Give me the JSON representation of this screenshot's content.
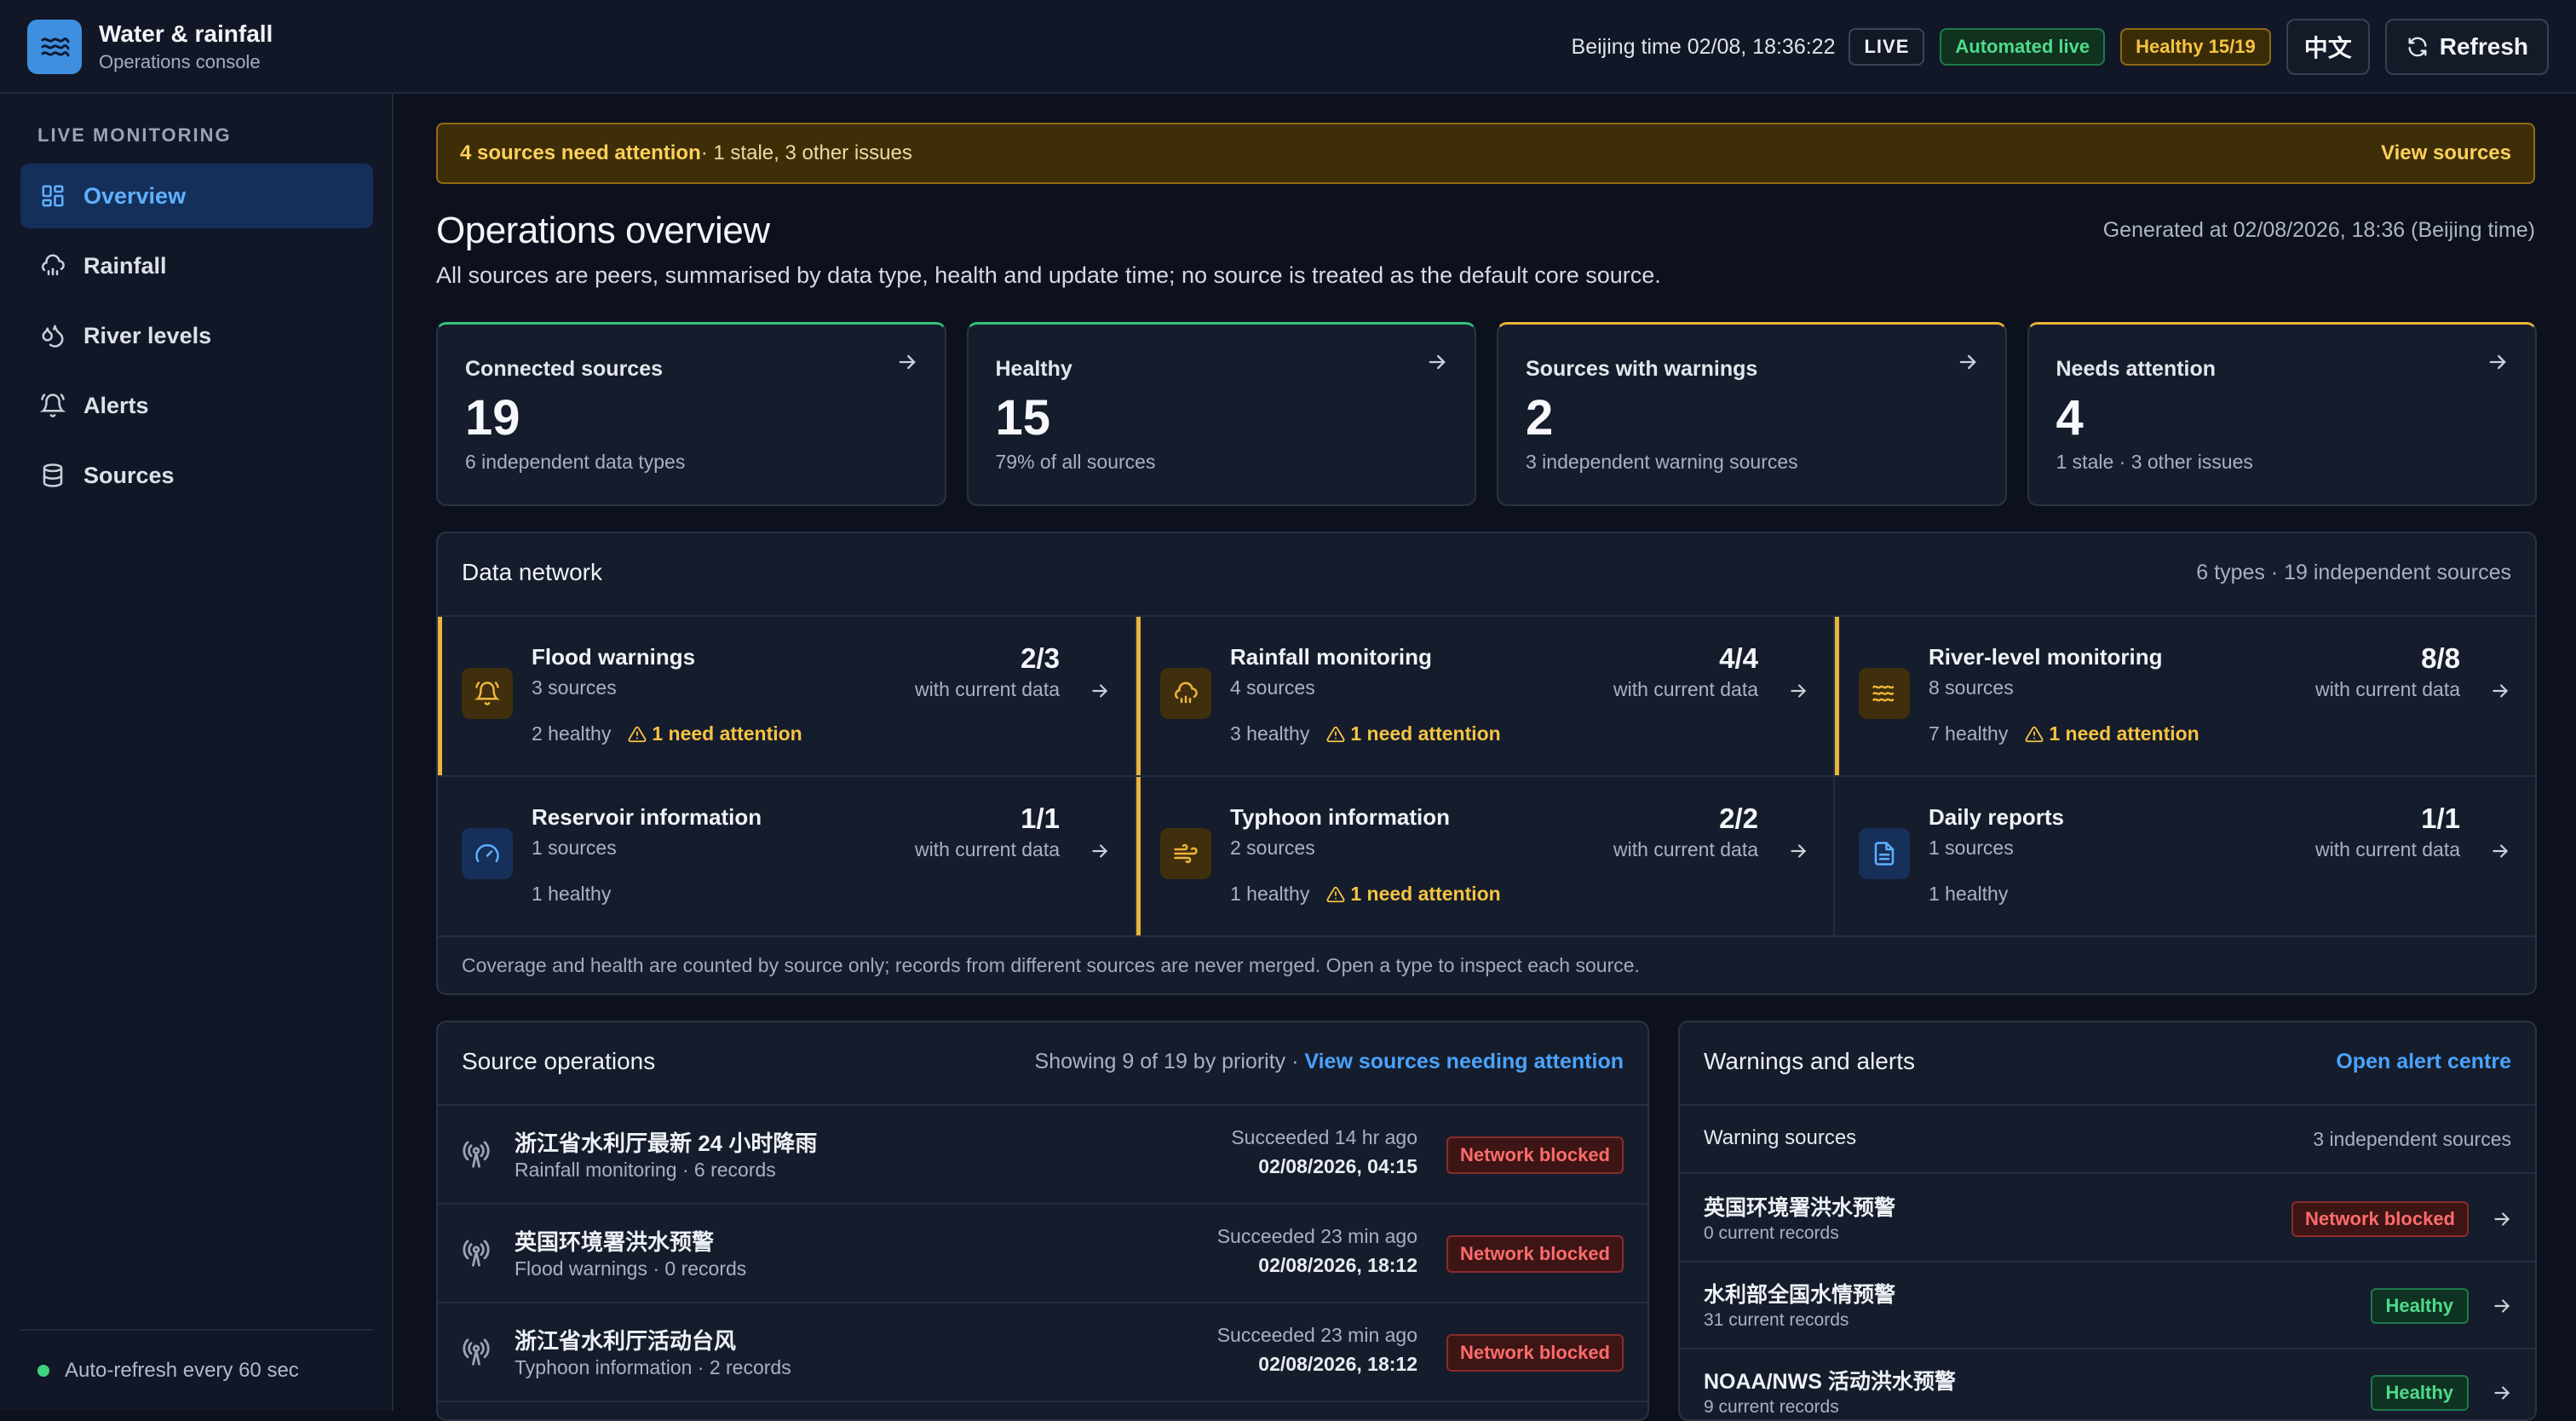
{
  "app": {
    "name": "Water & rainfall",
    "subtitle": "Operations console"
  },
  "header": {
    "time": "Beijing time 02/08, 18:36:22",
    "live": "LIVE",
    "auto": "Automated live",
    "healthy": "Healthy 15/19",
    "lang": "中文",
    "refresh": "Refresh"
  },
  "sidebar": {
    "section": "LIVE MONITORING",
    "items": [
      {
        "label": "Overview",
        "icon": "grid-icon"
      },
      {
        "label": "Rainfall",
        "icon": "cloud-rain-icon"
      },
      {
        "label": "River levels",
        "icon": "droplets-icon"
      },
      {
        "label": "Alerts",
        "icon": "bell-icon"
      },
      {
        "label": "Sources",
        "icon": "database-icon"
      }
    ],
    "footer": "Auto-refresh every 60 sec"
  },
  "banner": {
    "strong": "4 sources need attention",
    "rest": " · 1 stale, 3 other issues",
    "link": "View sources"
  },
  "overview": {
    "title": "Operations overview",
    "generated": "Generated at 02/08/2026, 18:36 (Beijing time)",
    "desc": "All sources are peers, summarised by data type, health and update time; no source is treated as the default core source."
  },
  "kpis": [
    {
      "label": "Connected sources",
      "value": "19",
      "sub": "6 independent data types"
    },
    {
      "label": "Healthy",
      "value": "15",
      "sub": "79% of all sources"
    },
    {
      "label": "Sources with warnings",
      "value": "2",
      "sub": "3 independent warning sources"
    },
    {
      "label": "Needs attention",
      "value": "4",
      "sub": "1 stale · 3 other issues"
    }
  ],
  "network": {
    "title": "Data network",
    "summary": "6 types · 19 independent sources",
    "cur_label": "with current data",
    "types": [
      {
        "name": "Flood warnings",
        "count": "3 sources",
        "healthy": "2 healthy",
        "need": "1 need attention",
        "ratio": "2/3"
      },
      {
        "name": "Rainfall monitoring",
        "count": "4 sources",
        "healthy": "3 healthy",
        "need": "1 need attention",
        "ratio": "4/4"
      },
      {
        "name": "River-level monitoring",
        "count": "8 sources",
        "healthy": "7 healthy",
        "need": "1 need attention",
        "ratio": "8/8"
      },
      {
        "name": "Reservoir information",
        "count": "1 sources",
        "healthy": "1 healthy",
        "need": "",
        "ratio": "1/1"
      },
      {
        "name": "Typhoon information",
        "count": "2 sources",
        "healthy": "1 healthy",
        "need": "1 need attention",
        "ratio": "2/2"
      },
      {
        "name": "Daily reports",
        "count": "1 sources",
        "healthy": "1 healthy",
        "need": "",
        "ratio": "1/1"
      }
    ],
    "footer": "Coverage and health are counted by source only; records from different sources are never merged. Open a type to inspect each source."
  },
  "ops": {
    "title": "Source operations",
    "showing": "Showing 9 of 19 by priority · ",
    "link": "View sources needing attention",
    "rows": [
      {
        "name": "浙江省水利厅最新 24 小时降雨",
        "sub": "Rainfall monitoring · 6 records",
        "when": "Succeeded 14 hr ago",
        "date": "02/08/2026, 04:15",
        "status": "Network blocked"
      },
      {
        "name": "英国环境署洪水预警",
        "sub": "Flood warnings · 0 records",
        "when": "Succeeded 23 min ago",
        "date": "02/08/2026, 18:12",
        "status": "Network blocked"
      },
      {
        "name": "浙江省水利厅活动台风",
        "sub": "Typhoon information · 2 records",
        "when": "Succeeded 23 min ago",
        "date": "02/08/2026, 18:12",
        "status": "Network blocked"
      }
    ]
  },
  "alerts": {
    "title": "Warnings and alerts",
    "link": "Open alert centre",
    "head_left": "Warning sources",
    "head_right": "3 independent sources",
    "rows": [
      {
        "name": "英国环境署洪水预警",
        "sub": "0 current records",
        "status": "Network blocked"
      },
      {
        "name": "水利部全国水情预警",
        "sub": "31 current records",
        "status": "Healthy"
      },
      {
        "name": "NOAA/NWS 活动洪水预警",
        "sub": "9 current records",
        "status": "Healthy"
      }
    ]
  },
  "colors": {
    "accent": "#4aa3ff",
    "warning": "#f6c343",
    "danger": "#ff6b6b",
    "ok": "#4fdb8c",
    "bg": "#0c111d"
  }
}
